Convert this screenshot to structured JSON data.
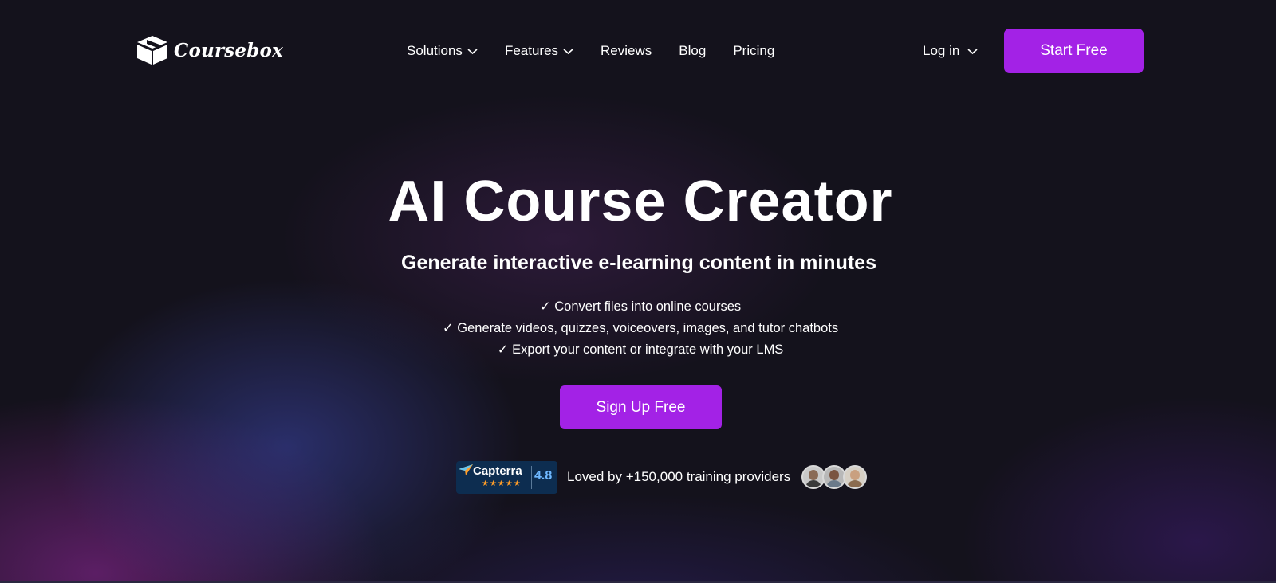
{
  "brand": {
    "name": "Coursebox",
    "logo_icon": "box-icon"
  },
  "nav": {
    "items": [
      {
        "label": "Solutions",
        "dropdown": true
      },
      {
        "label": "Features",
        "dropdown": true
      },
      {
        "label": "Reviews",
        "dropdown": false
      },
      {
        "label": "Blog",
        "dropdown": false
      },
      {
        "label": "Pricing",
        "dropdown": false
      }
    ],
    "login_label": "Log in",
    "start_label": "Start Free"
  },
  "hero": {
    "title": "AI Course Creator",
    "subtitle": "Generate interactive e-learning content in minutes",
    "checks": [
      "✓ Convert files into online courses",
      "✓ Generate videos, quizzes, voiceovers, images, and tutor chatbots",
      "✓ Export your content or integrate with your LMS"
    ],
    "cta_label": "Sign Up Free"
  },
  "proof": {
    "badge_name": "Capterra",
    "badge_stars": "★★★★★",
    "badge_score": "4.8",
    "text": "Loved by +150,000 training providers"
  },
  "colors": {
    "accent": "#a322e6",
    "background": "#14121c",
    "capterra_bg": "#0d2d50",
    "star": "#ff9d28"
  }
}
